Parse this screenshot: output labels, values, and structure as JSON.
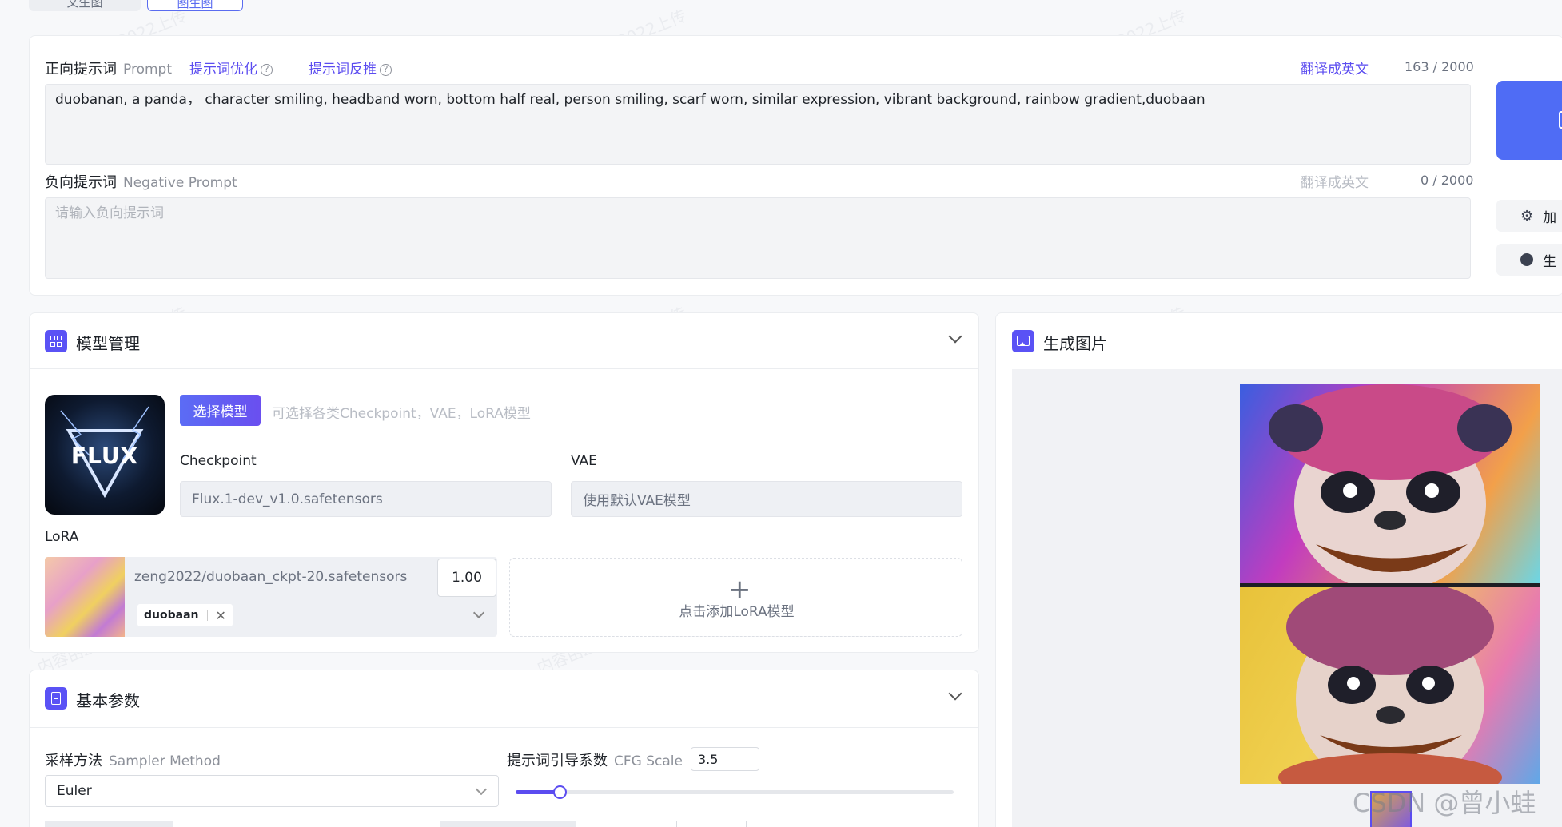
{
  "top_tabs": [
    "文生图",
    "图生图"
  ],
  "prompt": {
    "label_cn": "正向提示词",
    "label_en": "Prompt",
    "optimize_link": "提示词优化",
    "reverse_link": "提示词反推",
    "translate_link": "翻译成英文",
    "counter": "163 / 2000",
    "value": "duobanan, a panda， character smiling, headband worn, bottom half real, person smiling, scarf worn, similar expression, vibrant background, rainbow gradient,duobaan"
  },
  "negative_prompt": {
    "label_cn": "负向提示词",
    "label_en": "Negative Prompt",
    "translate_link": "翻译成英文",
    "counter": "0 / 2000",
    "placeholder": "请输入负向提示词"
  },
  "side_buttons": {
    "btn1": "加",
    "btn2": "生"
  },
  "model_mgmt": {
    "title": "模型管理",
    "logo_text": "FLUX",
    "select_button": "选择模型",
    "hint": "可选择各类Checkpoint，VAE，LoRA模型",
    "checkpoint_label": "Checkpoint",
    "checkpoint_value": "Flux.1-dev_v1.0.safetensors",
    "vae_label": "VAE",
    "vae_value": "使用默认VAE模型",
    "lora_label": "LoRA",
    "lora_name": "zeng2022/duobaan_ckpt-20.safetensors",
    "lora_weight": "1.00",
    "lora_tag": "duobaan",
    "add_lora": "点击添加LoRA模型"
  },
  "gen_image": {
    "title": "生成图片"
  },
  "basic_params": {
    "title": "基本参数",
    "sampler_cn": "采样方法",
    "sampler_en": "Sampler Method",
    "sampler_value": "Euler",
    "cfg_cn": "提示词引导系数",
    "cfg_en": "CFG Scale",
    "cfg_value": "3.5",
    "cfg_slider_fraction": 0.1
  },
  "footer_mark": "CSDN @曾小蛙",
  "watermark_text": "内容由zeng2022上传",
  "colors": {
    "accent": "#5b4cf0",
    "primary_blue": "#5a6cf0"
  }
}
